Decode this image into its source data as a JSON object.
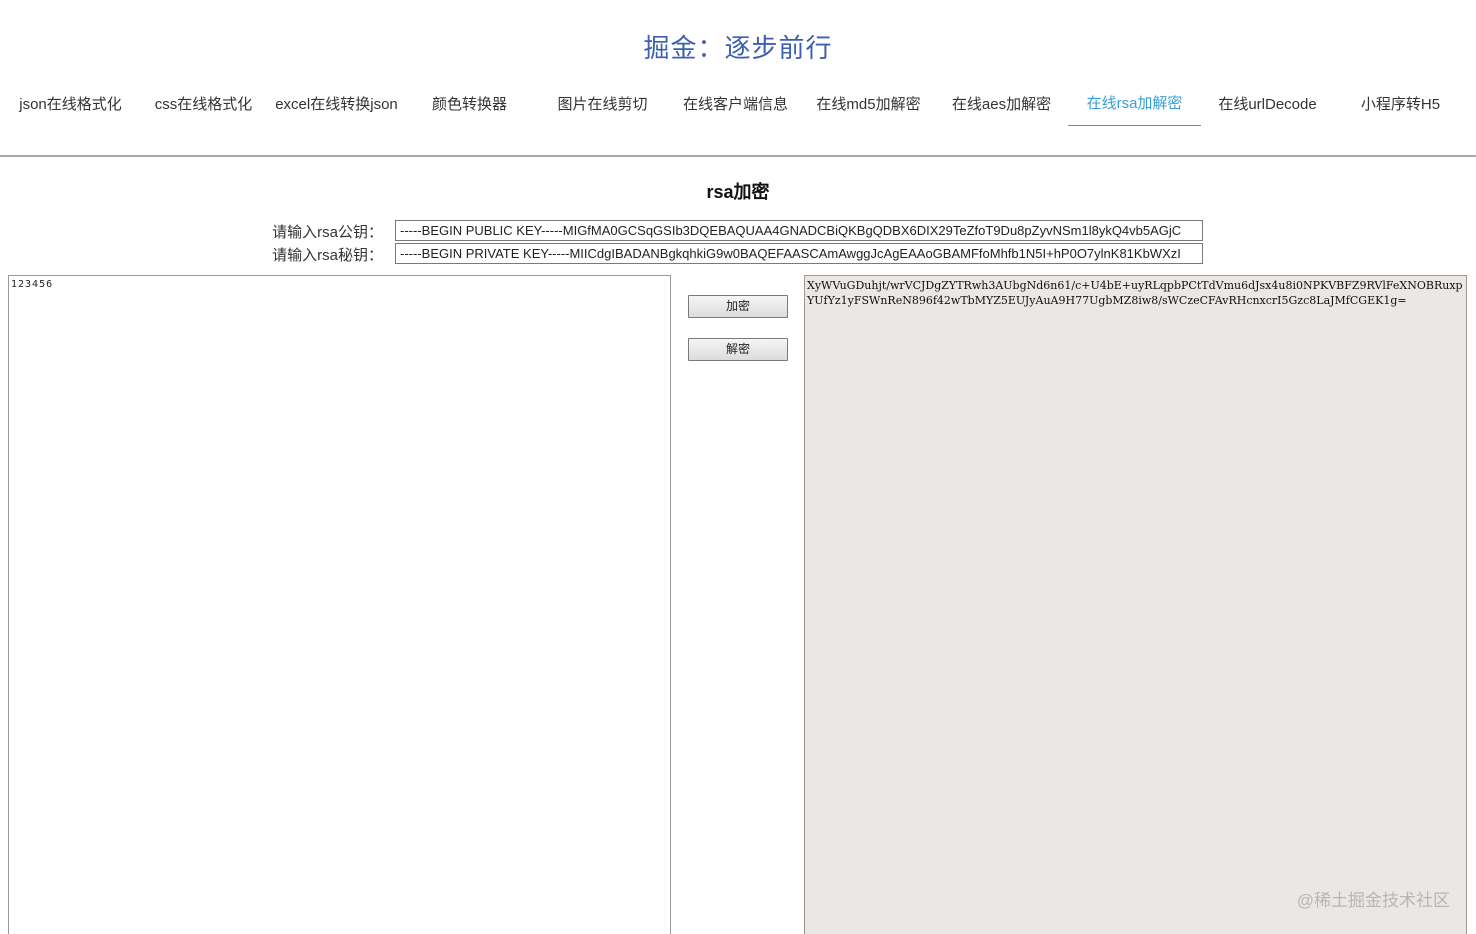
{
  "header": {
    "title": "掘金：逐步前行"
  },
  "nav": {
    "items": [
      {
        "label": "json在线格式化",
        "active": false
      },
      {
        "label": "css在线格式化",
        "active": false
      },
      {
        "label": "excel在线转换json",
        "active": false
      },
      {
        "label": "颜色转换器",
        "active": false
      },
      {
        "label": "图片在线剪切",
        "active": false
      },
      {
        "label": "在线客户端信息",
        "active": false
      },
      {
        "label": "在线md5加解密",
        "active": false
      },
      {
        "label": "在线aes加解密",
        "active": false
      },
      {
        "label": "在线rsa加解密",
        "active": true
      },
      {
        "label": "在线urlDecode",
        "active": false
      },
      {
        "label": "小程序转H5",
        "active": false
      }
    ],
    "active_color": "#3a9fd8"
  },
  "main": {
    "section_title": "rsa加密",
    "public_key": {
      "label": "请输入rsa公钥：",
      "value": "-----BEGIN PUBLIC KEY-----MIGfMA0GCSqGSIb3DQEBAQUAA4GNADCBiQKBgQDBX6DIX29TeZfoT9Du8pZyvNSm1l8ykQ4vb5AGjC"
    },
    "private_key": {
      "label": "请输入rsa秘钥：",
      "value": "-----BEGIN PRIVATE KEY-----MIICdgIBADANBgkqhkiG9w0BAQEFAASCAmAwggJcAgEAAoGBAMFfoMhfb1N5I+hP0O7ylnK81KbWXzI"
    },
    "input_text": "123456",
    "output_text": "XyWVuGDuhjt/wrVCJDgZYTRwh3AUbgNd6n61/c+U4bE+uyRLqpbPCtTdVmu6dJsx4u8i0NPKVBFZ9RVlFeXNOBRuxpYUfYz1yFSWnReN896f42wTbMYZ5EUJyAuA9H77UgbMZ8iw8/sWCzeCFAvRHcnxcrI5Gzc8LaJMfCGEK1g=",
    "encrypt_button": "加密",
    "decrypt_button": "解密"
  },
  "watermark": {
    "text": "@稀土掘金技术社区"
  },
  "colors": {
    "title": "#3d5fb0",
    "output_bg": "#ebe7e5"
  }
}
